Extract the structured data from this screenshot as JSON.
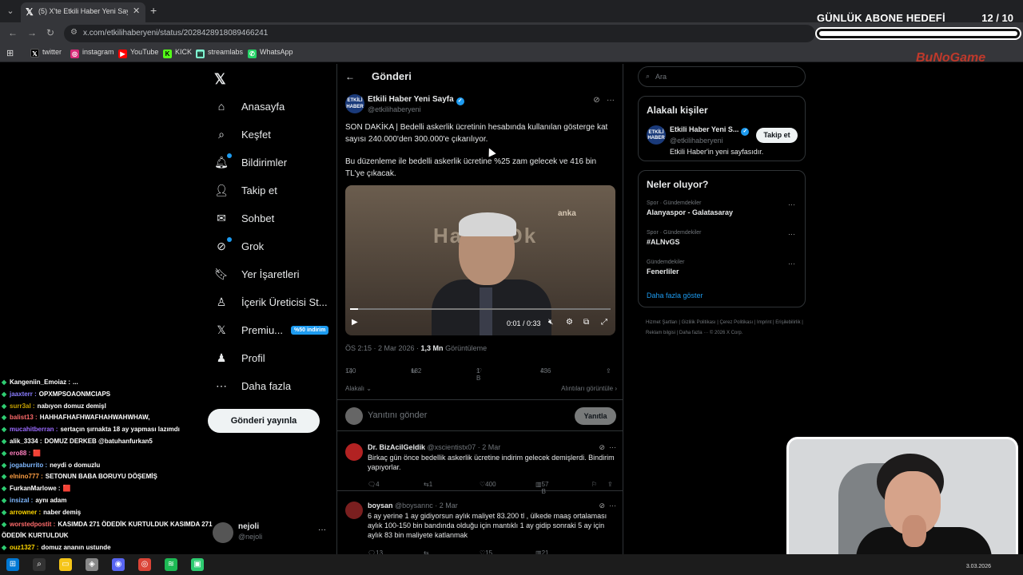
{
  "browser": {
    "tab_title": "(5) X'te Etkili Haber Yeni Sayfa: \"",
    "url": "x.com/etkilihaberyeni/status/2028428918089466241",
    "bookmarks": [
      {
        "label": "twitter",
        "icon": "x-icon",
        "color": "#000000"
      },
      {
        "label": "instagram",
        "icon": "instagram-icon",
        "color": "#d62976"
      },
      {
        "label": "YouTube",
        "icon": "youtube-icon",
        "color": "#ff0000"
      },
      {
        "label": "KICK",
        "icon": "kick-icon",
        "color": "#53fc18"
      },
      {
        "label": "streamlabs",
        "icon": "streamlabs-icon",
        "color": "#80f5d2"
      },
      {
        "label": "WhatsApp",
        "icon": "whatsapp-icon",
        "color": "#25d366"
      }
    ]
  },
  "overlay": {
    "sub_goal_label": "GÜNLÜK ABONE HEDEFİ",
    "sub_goal_count": "12 / 10",
    "sub_goal_progress": 1.0,
    "brand": "BuNoGame"
  },
  "leftnav": {
    "items": [
      {
        "label": "Anasayfa",
        "icon": "home-icon"
      },
      {
        "label": "Keşfet",
        "icon": "search-icon"
      },
      {
        "label": "Bildirimler",
        "icon": "bell-icon"
      },
      {
        "label": "Takip et",
        "icon": "follow-icon"
      },
      {
        "label": "Sohbet",
        "icon": "mail-icon"
      },
      {
        "label": "Grok",
        "icon": "grok-icon"
      },
      {
        "label": "Yer İşaretleri",
        "icon": "bookmark-icon"
      },
      {
        "label": "İçerik Üreticisi St...",
        "icon": "creator-icon"
      },
      {
        "label": "Premiu...",
        "icon": "x-premium-icon"
      },
      {
        "label": "Profil",
        "icon": "profile-icon"
      },
      {
        "label": "Daha fazla",
        "icon": "more-icon"
      }
    ],
    "premium_badge": "%50 indirim",
    "post_button": "Gönderi yayınla",
    "user": {
      "name": "nejoli",
      "handle": "@nejoli"
    }
  },
  "main": {
    "header_title": "Gönderi",
    "tweet": {
      "author": "Etkili Haber Yeni Sayfa",
      "handle": "@etkilihaberyeni",
      "avatar_text": "ETKİLİ HABER",
      "text1": "SON DAKİKA | Bedelli askerlik ücretinin hesabında kullanılan gösterge kat sayısı 240.000'den 300.000'e çıkarılıyor.",
      "text2": "Bu düzenleme ile bedelli askerlik ücretine %25 zam gelecek ve 416 bin TL'ye çıkacak.",
      "video_time": "0:01 / 0:33",
      "video_progress": 0.03,
      "video_watermark": "anka",
      "video_wall_text": "Haber Dk",
      "time": "ÖS 2:15 · 2 Mar 2026 · ",
      "views": "1,3 Mn",
      "views_label": " Görüntüleme",
      "replies": "140",
      "retweets": "182",
      "likes": "1 B",
      "bookmarks": "436",
      "related_label": "Alakalı",
      "quotes_label": "Alıntıları görüntüle"
    },
    "reply_placeholder": "Yanıtını gönder",
    "reply_button": "Yanıtla",
    "replies": [
      {
        "name": "Dr. BizAcilGeldik",
        "meta": "@xscientistx07 · 2 Mar",
        "text": "Birkaç gün önce bedellik askerlik ücretine indirim gelecek demişlerdi. Bindirim yapıyorlar.",
        "replies": "4",
        "retweets": "1",
        "likes": "400",
        "views": "57 B"
      },
      {
        "name": "boysan",
        "meta": "@boysannc · 2 Mar",
        "text": "6 ay yerine 1 ay gidiyorsun aylık maliyet 83.200 tl , ülkede maaş ortalaması aylık 100-150 bin bandında olduğu için mantıklı 1 ay gidip sonraki 5 ay için aylık 83 bin maliyete katlanmak",
        "replies": "13",
        "retweets": "",
        "likes": "15",
        "views": "21 B"
      }
    ]
  },
  "right": {
    "search_placeholder": "Ara",
    "related_title": "Alakalı kişiler",
    "related_person": {
      "name": "Etkili Haber Yeni S...",
      "handle": "@etkilihaberyeni",
      "desc": "Etkili Haber'in yeni sayfasıdır.",
      "follow": "Takip et"
    },
    "trends_title": "Neler oluyor?",
    "trends": [
      {
        "context": "Spor · Gündemdekiler",
        "name": "Alanyaspor - Galatasaray"
      },
      {
        "context": "Spor · Gündemdekiler",
        "name": "#ALNvGS"
      },
      {
        "context": "Gündemdekiler",
        "name": "Fenerliler"
      }
    ],
    "show_more": "Daha fazla göster",
    "footer": "Hizmet Şartları  |  Gizlilik Politikası  |  Çerez Politikası  |  Imprint  |  Erişilebilirlik  |  Reklam bilgisi  |  Daha fazla ···  © 2026 X Corp."
  },
  "chat": [
    {
      "user": "Kangeniin_Emoiaz",
      "msg": "...",
      "color": "#ffffff"
    },
    {
      "user": "jaaxterr",
      "msg": "OPXMPSOAONMCIAPS",
      "color": "#8a7dff"
    },
    {
      "user": "surr3al",
      "msg": "nabıyon domuz demişl",
      "color": "#c8a200"
    },
    {
      "user": "balist13",
      "msg": "HAHHAFHAFHWAFHAHWAHWHAW,",
      "color": "#ff6b6b"
    },
    {
      "user": "mucahitberran",
      "msg": "sertaçın şırnakta 18 ay yapması lazımdı",
      "color": "#9b6bff"
    },
    {
      "user": "alik_3334",
      "msg": "DOMUZ DERKEB @batuhanfurkan5",
      "color": "#ffffff"
    },
    {
      "user": "ero88",
      "msg": "🟥",
      "color": "#ff7fbf"
    },
    {
      "user": "jogaburrito",
      "msg": "neydi o domuzlu",
      "color": "#7fb8ff"
    },
    {
      "user": "elnino777",
      "msg": "SETONUN BABA BORUYU DÖŞEMİŞ",
      "color": "#ff9f43"
    },
    {
      "user": "FurkanMarlowe",
      "msg": "🟥",
      "color": "#ffffff"
    },
    {
      "user": "insizal",
      "msg": "aynı adam",
      "color": "#7fb8ff"
    },
    {
      "user": "arrowner",
      "msg": "naber demiş",
      "color": "#ffd700"
    },
    {
      "user": "worstedpostit",
      "msg": "KASIMDA 271 ÖDEDİK KURTULDUK KASIMDA 271",
      "color": "#ff6b6b"
    },
    {
      "user": "",
      "msg": "ÖDEDİK KURTULDUK",
      "color": "#ffffff"
    },
    {
      "user": "ouz1327",
      "msg": "domuz ananın ustunde",
      "color": "#ffd700"
    }
  ],
  "taskbar": {
    "date": "3.03.2026",
    "apps": [
      "windows-icon",
      "search-icon",
      "explorer-icon",
      "app-icon",
      "discord-icon",
      "chrome-icon",
      "spotify-icon",
      "app-green-icon"
    ]
  }
}
